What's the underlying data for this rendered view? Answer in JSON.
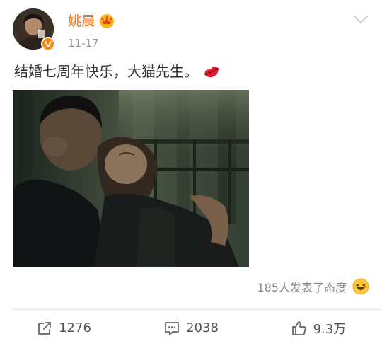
{
  "post": {
    "author": {
      "name": "姚晨",
      "avatar_icon": "avatar-photo",
      "verified_icon": "verified-v-badge",
      "member_icon": "crown-icon",
      "name_color": "#f86d0d",
      "badge_color": "#ff8200"
    },
    "timestamp": "11-17",
    "text": "结婚七周年快乐，大猫先生。",
    "text_emoji": "lips-kiss-icon",
    "more_icon": "chevron-down-icon",
    "image": {
      "kind": "photo"
    },
    "reactions": {
      "summary": "185人发表了态度",
      "icon": "laughing-face-icon"
    },
    "actions": {
      "repost": {
        "icon": "share-icon",
        "count": "1276"
      },
      "comment": {
        "icon": "comment-icon",
        "count": "2038"
      },
      "like": {
        "icon": "thumbs-up-icon",
        "count": "9.3万"
      }
    }
  }
}
